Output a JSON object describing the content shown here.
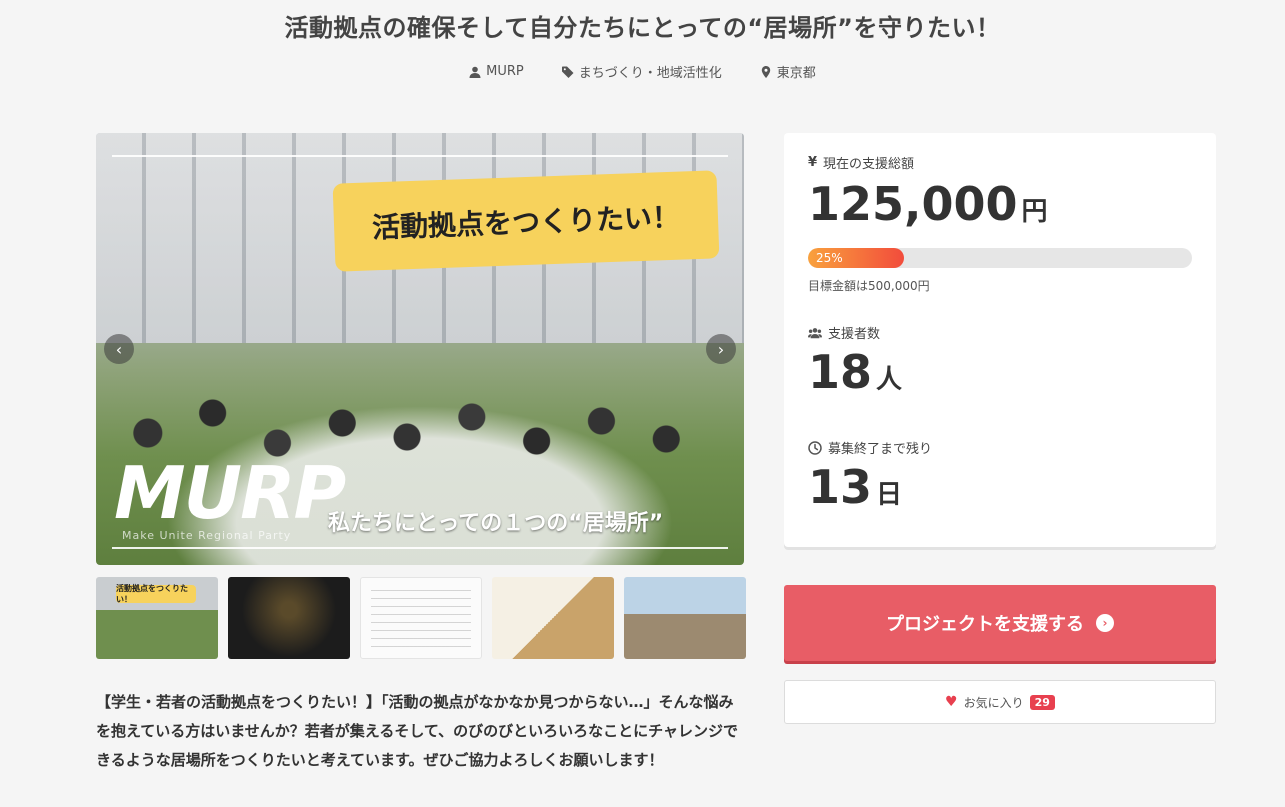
{
  "project": {
    "title": "活動拠点の確保そして自分たちにとっての“居場所”を守りたい！",
    "owner": "MURP",
    "category": "まちづくり・地域活性化",
    "location": "東京都"
  },
  "hero": {
    "banner_text": "活動拠点をつくりたい！",
    "logo_text": "MURP",
    "logo_subtext": "Make Unite Regional Party",
    "tagline": "私たちにとっての１つの“居場所”",
    "prev_icon": "chevron-left-icon",
    "next_icon": "chevron-right-icon"
  },
  "thumbnails": [
    {
      "label": "活動拠点をつくりたい！"
    },
    {
      "label": ""
    },
    {
      "label": ""
    },
    {
      "label": ""
    },
    {
      "label": ""
    }
  ],
  "description": "【学生・若者の活動拠点をつくりたい！】「活動の拠点がなかなか見つからない…」そんな悩みを抱えている方はいませんか？若者が集えるそして、のびのびといろいろなことにチャレンジできるような居場所をつくりたいと考えています。ぜひご協力よろしくお願いします！",
  "stats": {
    "funding_label": "現在の支援総額",
    "funding_amount": "125,000",
    "funding_unit": "円",
    "progress_percent": 25,
    "progress_text": "25%",
    "goal_text": "目標金額は500,000円",
    "supporters_label": "支援者数",
    "supporters_count": "18",
    "supporters_unit": "人",
    "remaining_label": "募集終了まで残り",
    "remaining_days": "13",
    "remaining_unit": "日"
  },
  "actions": {
    "support_label": "プロジェクトを支援する",
    "favorite_label": "お気に入り",
    "favorite_count": "29"
  },
  "colors": {
    "accent": "#e85d66",
    "progress_start": "#f9a13d",
    "progress_end": "#f24c3c",
    "banner_yellow": "#f7d25c",
    "heart": "#e8404f"
  }
}
